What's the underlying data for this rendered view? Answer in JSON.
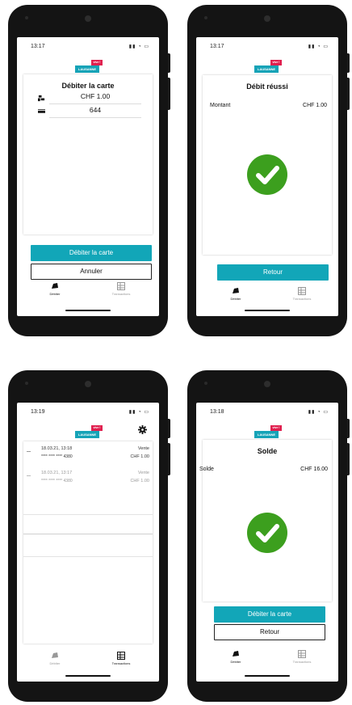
{
  "common": {
    "logo_ribbon": "LAUSANNE",
    "logo_tag": "vive !",
    "tab_debit": "Débiter",
    "tab_transactions": "Transactions",
    "status_icons": "▮▮ ◔ ▭"
  },
  "screen1": {
    "time": "13:17",
    "title": "Débiter la carte",
    "amount": "CHF 1.00",
    "card_code": "644",
    "primary_button": "Débiter la carte",
    "secondary_button": "Annuler"
  },
  "screen2": {
    "time": "13:17",
    "title": "Débit réussi",
    "label": "Montant",
    "value": "CHF 1.00",
    "button": "Retour"
  },
  "screen3": {
    "time": "13:19",
    "transactions": [
      {
        "datetime": "18.03.21, 13:18",
        "card": "**** **** **** 4380",
        "type": "Vente",
        "amount": "CHF 1.00"
      },
      {
        "datetime": "18.03.21, 13:17",
        "card": "**** **** **** 4380",
        "type": "Vente",
        "amount": "CHF 1.00"
      }
    ]
  },
  "screen4": {
    "time": "13:18",
    "title": "Solde",
    "label": "Solde",
    "value": "CHF 16.00",
    "primary_button": "Débiter la carte",
    "secondary_button": "Retour"
  },
  "colors": {
    "accent": "#12a6b8",
    "success": "#3c9f1e",
    "brand_red": "#e0204f"
  }
}
